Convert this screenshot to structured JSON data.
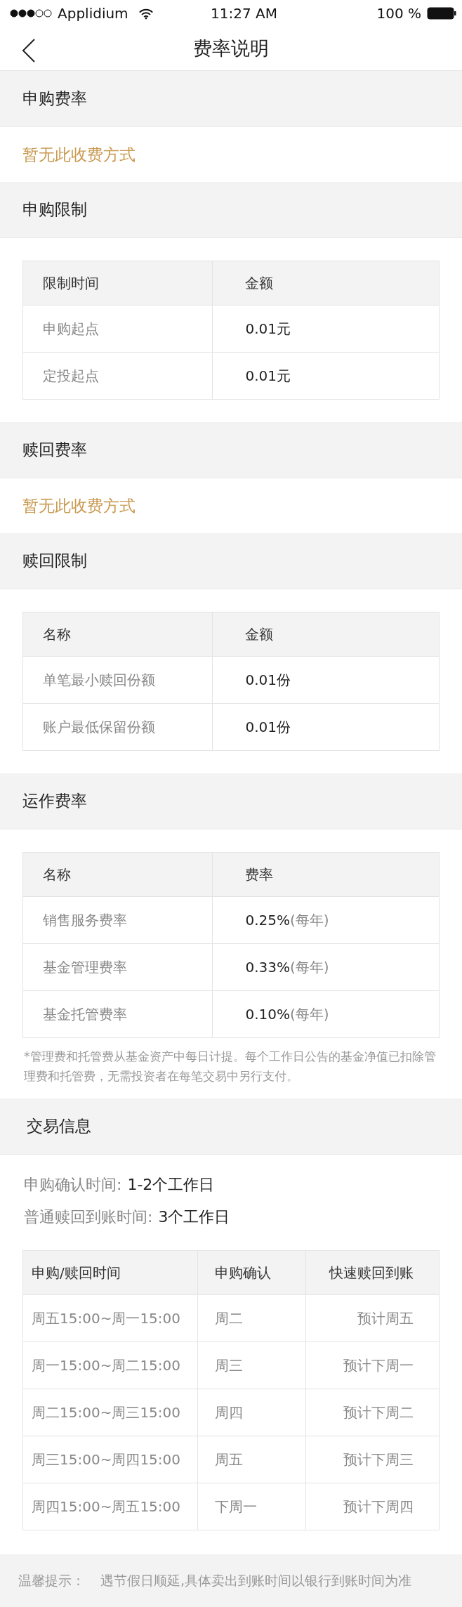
{
  "status_bar": {
    "carrier": "Applidium",
    "time": "11:27 AM",
    "battery": "100 %"
  },
  "nav": {
    "title": "费率说明"
  },
  "sections": [
    {
      "kind": "note",
      "title": "申购费率",
      "note": "暂无此收费方式"
    },
    {
      "kind": "table",
      "title": "申购限制",
      "columns": [
        "限制时间",
        "金额"
      ],
      "rows": [
        [
          {
            "text": "申购起点"
          },
          {
            "text": "0.01元"
          }
        ],
        [
          {
            "text": "定投起点"
          },
          {
            "text": "0.01元"
          }
        ]
      ]
    },
    {
      "kind": "note",
      "title": "赎回费率",
      "note": "暂无此收费方式"
    },
    {
      "kind": "table",
      "title": "赎回限制",
      "columns": [
        "名称",
        "金额"
      ],
      "rows": [
        [
          {
            "text": "单笔最小赎回份额"
          },
          {
            "text": "0.01份"
          }
        ],
        [
          {
            "text": "账户最低保留份额"
          },
          {
            "text": "0.01份"
          }
        ]
      ]
    },
    {
      "kind": "table",
      "title": "运作费率",
      "columns": [
        "名称",
        "费率"
      ],
      "rows": [
        [
          {
            "text": "销售服务费率"
          },
          {
            "text": "0.25%",
            "suffix": "(每年)"
          }
        ],
        [
          {
            "text": "基金管理费率"
          },
          {
            "text": "0.33%",
            "suffix": "(每年)"
          }
        ],
        [
          {
            "text": "基金托管费率"
          },
          {
            "text": "0.10%",
            "suffix": "(每年)"
          }
        ]
      ],
      "footnote": "*管理费和托管费从基金资产中每日计提。每个工作日公告的基金净值已扣除管理费和托管费，无需投资者在每笔交易中另行支付。"
    },
    {
      "kind": "trade",
      "title": "交易信息",
      "info": [
        {
          "label": "申购确认时间:",
          "value": "1-2个工作日"
        },
        {
          "label": "普通赎回到账时间:",
          "value": "3个工作日"
        }
      ],
      "columns": [
        "申购/赎回时间",
        "申购确认",
        "快速赎回到账"
      ],
      "rows": [
        [
          {
            "text": "周五15:00~周一15:00"
          },
          {
            "text": "周二"
          },
          {
            "text": "预计周五"
          }
        ],
        [
          {
            "text": "周一15:00~周二15:00"
          },
          {
            "text": "周三"
          },
          {
            "text": "预计下周一"
          }
        ],
        [
          {
            "text": "周二15:00~周三15:00"
          },
          {
            "text": "周四"
          },
          {
            "text": "预计下周二"
          }
        ],
        [
          {
            "text": "周三15:00~周四15:00"
          },
          {
            "text": "周五"
          },
          {
            "text": "预计下周三"
          }
        ],
        [
          {
            "text": "周四15:00~周五15:00"
          },
          {
            "text": "下周一"
          },
          {
            "text": "预计下周四"
          }
        ]
      ]
    }
  ],
  "tip": {
    "label": "温馨提示：",
    "text": "遇节假日顺延,具体卖出到账时间以银行到账时间为准"
  }
}
